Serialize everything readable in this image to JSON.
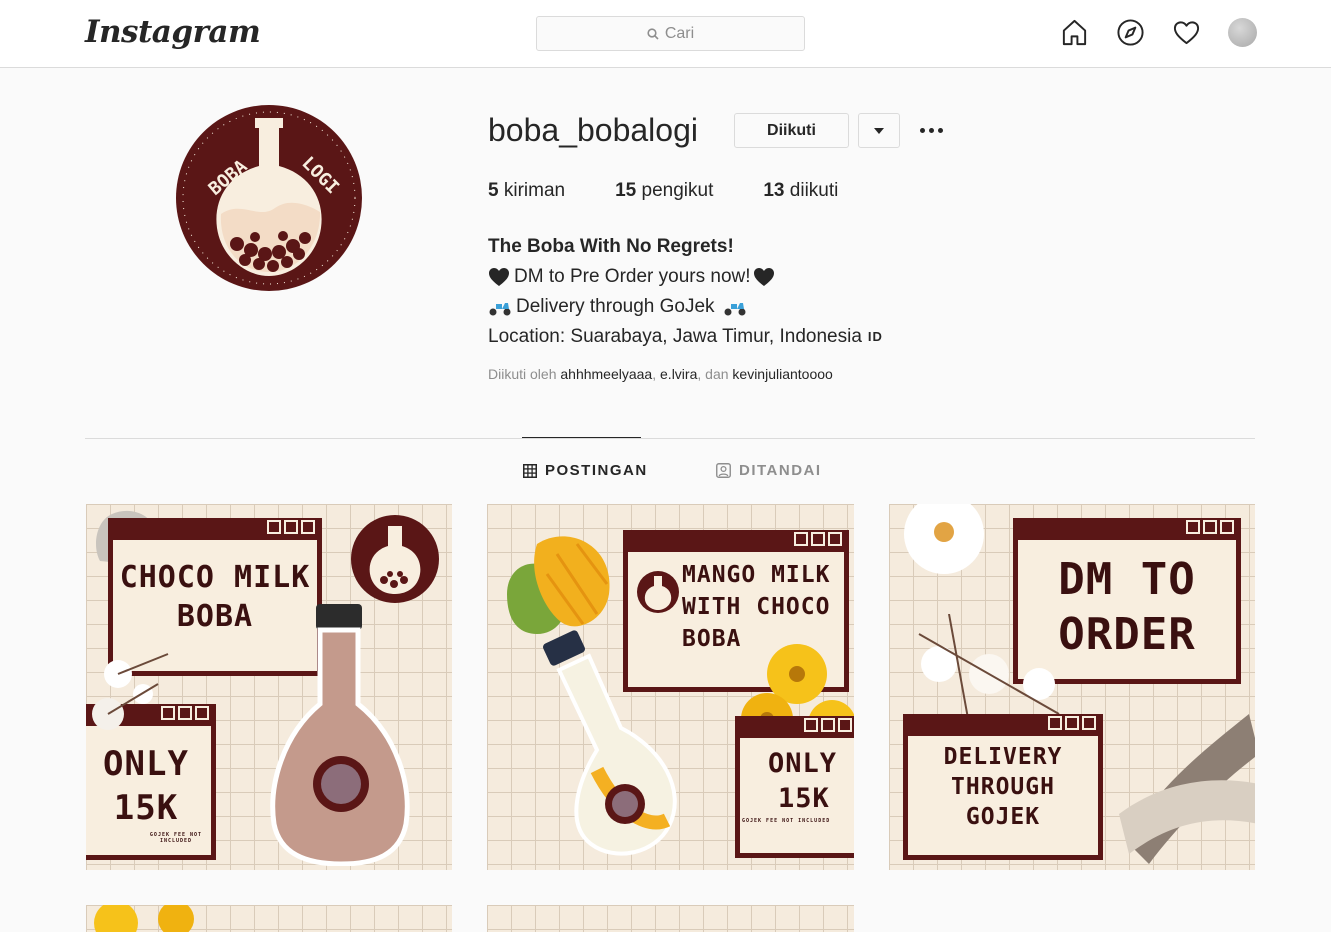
{
  "app": {
    "logo": "Instagram"
  },
  "search": {
    "placeholder": "Cari"
  },
  "nav": {
    "icons": [
      "home-icon",
      "explore-compass-icon",
      "activity-heart-icon",
      "profile-avatar"
    ]
  },
  "profile": {
    "username": "boba_bobalogi",
    "follow_label": "Diikuti",
    "stats": [
      {
        "count": "5",
        "label": "kiriman"
      },
      {
        "count": "15",
        "label": "pengikut"
      },
      {
        "count": "13",
        "label": "diikuti"
      }
    ],
    "bio": {
      "name": "The Boba With No Regrets!",
      "line1": "DM to Pre Order yours now!",
      "line2": "Delivery through GoJek",
      "line3": "Location: Suarabaya, Jawa Timur, Indonesia",
      "flag": "ID"
    },
    "followed_by": {
      "prefix": "Diikuti oleh",
      "users": [
        "ahhhmeelyaaa",
        "e.lvira",
        "kevinjuliantoooo"
      ],
      "sep": ",",
      "and": "dan"
    },
    "logo_text": {
      "left": "BOBA",
      "right": "LOGI"
    }
  },
  "tabs": [
    {
      "label": "POSTINGAN",
      "active": true
    },
    {
      "label": "DITANDAI",
      "active": false
    }
  ],
  "posts": [
    {
      "title": "CHOCO MILK BOBA",
      "t1": "CHOCO MILK",
      "t2": "BOBA",
      "price1": "ONLY",
      "price2": "15K",
      "note": "GOJEK FEE NOT INCLUDED"
    },
    {
      "t1": "MANGO MILK",
      "t2": "WITH CHOCO",
      "t3": "BOBA",
      "price1": "ONLY",
      "price2": "15K",
      "note": "GOJEK FEE NOT INCLUDED"
    },
    {
      "t1": "DM TO",
      "t2": "ORDER",
      "d1": "DELIVERY",
      "d2": "THROUGH",
      "d3": "GOJEK"
    }
  ],
  "colors": {
    "brand_maroon": "#5a1616",
    "cream": "#f8eedf",
    "border": "#dbdbdb"
  }
}
